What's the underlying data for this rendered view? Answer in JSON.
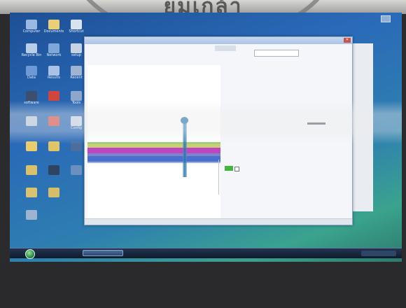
{
  "watermark": {
    "text": "ยมเกล้า"
  },
  "desktop": {
    "icons": [
      {
        "label": "Computer",
        "icon": "computer-icon"
      },
      {
        "label": "Documents",
        "icon": "folder-icon"
      },
      {
        "label": "Recycle Bin",
        "icon": "recycle-bin-icon"
      },
      {
        "label": "Network",
        "icon": "network-icon"
      },
      {
        "label": "software",
        "icon": "app-icon"
      },
      {
        "label": "Shortcut",
        "icon": "shortcut-icon"
      },
      {
        "label": "setup",
        "icon": "setup-icon"
      },
      {
        "label": "Data",
        "icon": "folder-icon"
      },
      {
        "label": "Results",
        "icon": "folder-icon"
      },
      {
        "label": "Recent",
        "icon": "folder-icon"
      },
      {
        "label": "Tools",
        "icon": "tools-icon"
      },
      {
        "label": "Config",
        "icon": "config-icon"
      }
    ]
  },
  "window": {
    "title": "",
    "close_glyph": "✕",
    "panel": {
      "header": "",
      "rows": [
        {
          "key": "",
          "value": ""
        },
        {
          "key": "",
          "value": ""
        },
        {
          "key": "",
          "value": ""
        },
        {
          "key": "",
          "value": ""
        },
        {
          "key": "",
          "value": ""
        },
        {
          "key": "",
          "value": ""
        },
        {
          "key": "",
          "value": ""
        },
        {
          "key": "",
          "value": ""
        },
        {
          "key": "",
          "value": ""
        },
        {
          "key": "",
          "value": ""
        }
      ],
      "link": ""
    },
    "status": ""
  },
  "taskbar": {
    "start_icon": "windows-orb-icon",
    "task_item_label": "",
    "clock": ""
  },
  "colors": {
    "desktop_top": "#1d4f95",
    "desktop_bottom": "#3aa38e",
    "plot_band_green": "#43b53b",
    "plot_band_magenta": "#c045c0",
    "plot_band_blue": "#4a6fd0",
    "probe_blue": "#2d7bb1"
  }
}
